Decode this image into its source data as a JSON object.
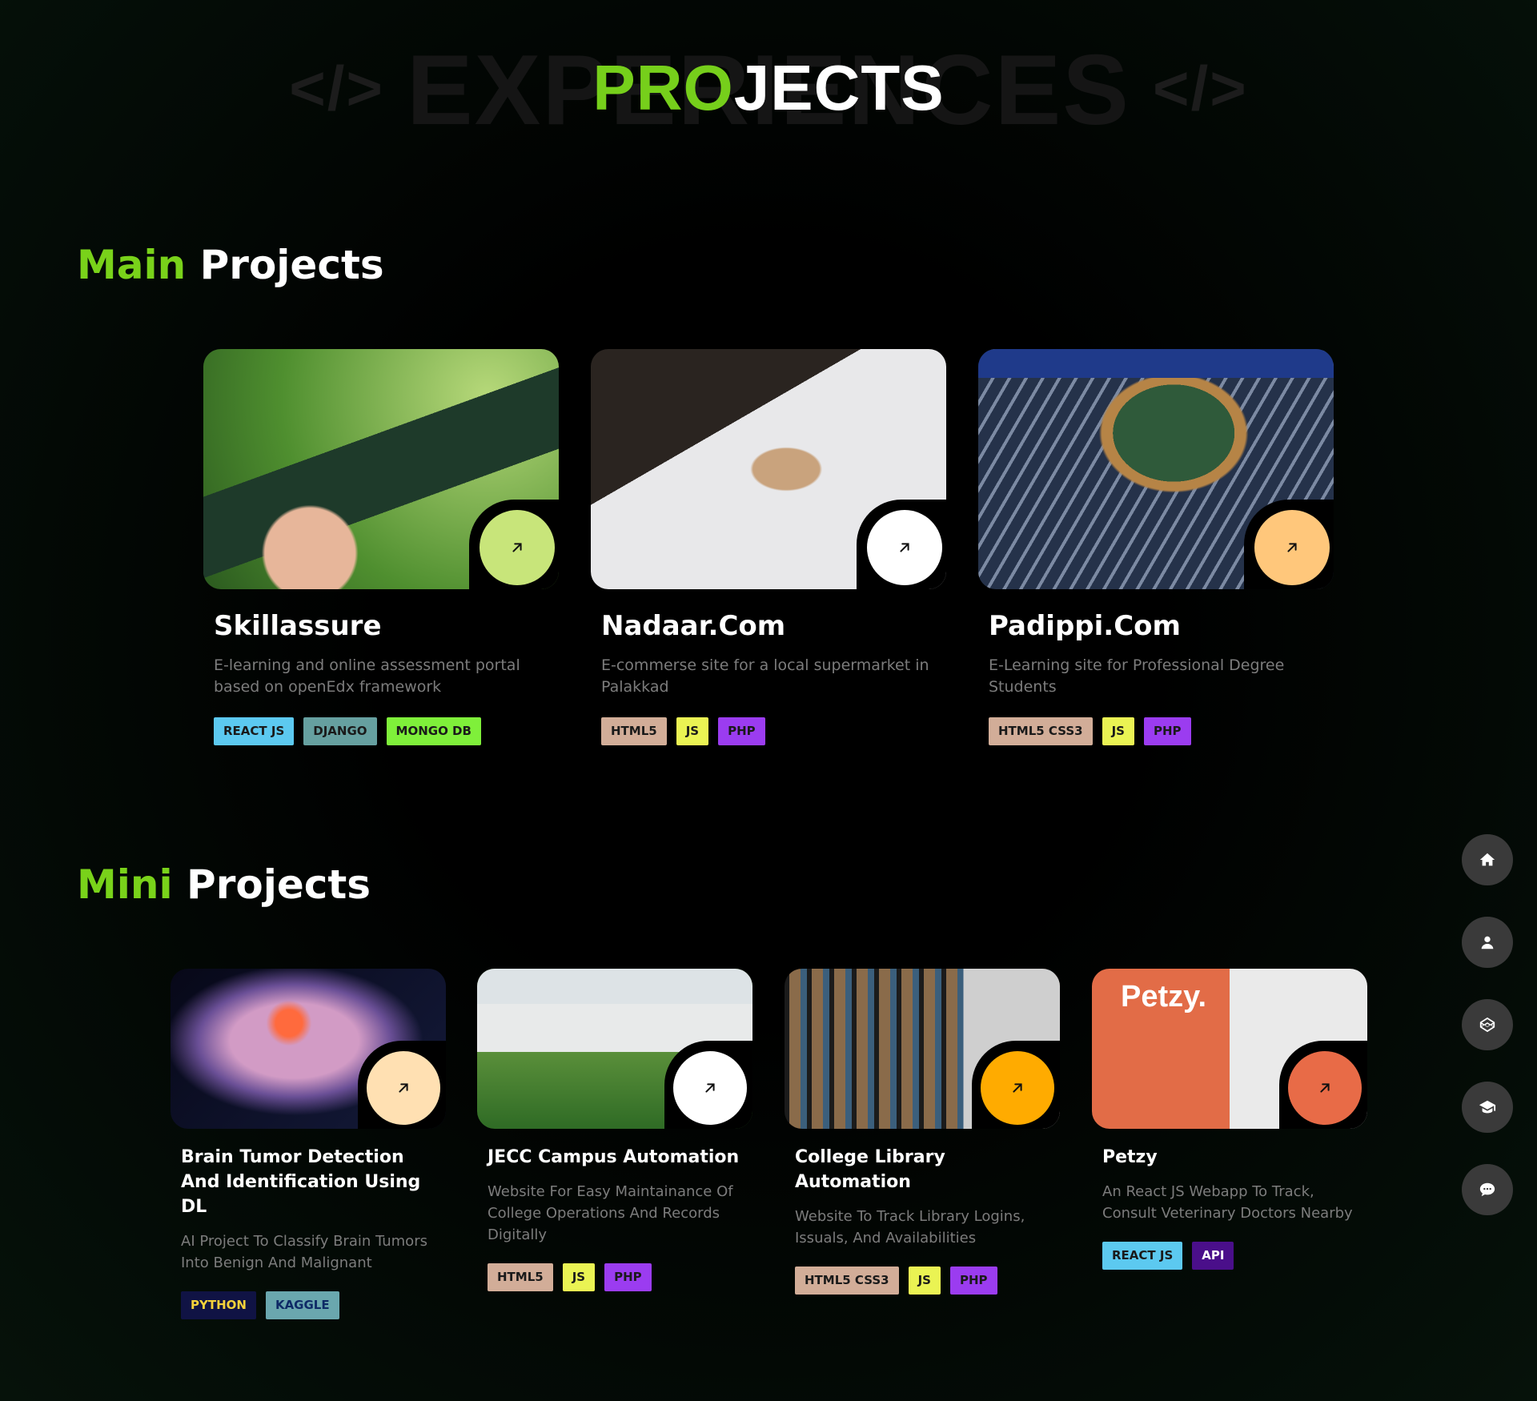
{
  "hero": {
    "bg_code_left": "</>",
    "bg_word": "EXPERIENCES",
    "bg_code_right": "</>",
    "title_accent": "PRO",
    "title_rest": "JECTS"
  },
  "main_section": {
    "accent": "Main",
    "rest": " Projects"
  },
  "mini_section": {
    "accent": "Mini",
    "rest": " Projects"
  },
  "main_projects": [
    {
      "title": "Skillassure",
      "description": "E-learning and online assessment portal based on openEdx framework",
      "image_icon": "e-learning-tablet-image",
      "arrow_color": "#c8e57a",
      "tags": [
        {
          "label": "REACT JS",
          "color": "#5cc9f0"
        },
        {
          "label": "DJANGO",
          "color": "#66a0a0"
        },
        {
          "label": "MONGO DB",
          "color": "#7ff03a"
        }
      ]
    },
    {
      "title": "Nadaar.Com",
      "description": "E-commerse site for a local supermarket in Palakkad",
      "image_icon": "shopping-cart-image",
      "arrow_color": "#ffffff",
      "tags": [
        {
          "label": "HTML5",
          "color": "#d2ad98"
        },
        {
          "label": "JS",
          "color": "#eaf353"
        },
        {
          "label": "PHP",
          "color": "#9b3cf0"
        }
      ]
    },
    {
      "title": "Padippi.Com",
      "description": "E-Learning site for Professional Degree Students",
      "image_icon": "e-learning-keyboard-image",
      "arrow_color": "#ffc77b",
      "tags": [
        {
          "label": "HTML5 CSS3",
          "color": "#d2ad98"
        },
        {
          "label": "JS",
          "color": "#eaf353"
        },
        {
          "label": "PHP",
          "color": "#9b3cf0"
        }
      ]
    }
  ],
  "mini_projects": [
    {
      "title": "Brain Tumor Detection And Identification Using DL",
      "description": "AI Project To Classify Brain Tumors Into Benign And Malignant",
      "image_icon": "brain-scan-image",
      "arrow_color": "#ffe0b2",
      "tags": [
        {
          "label": "PYTHON",
          "color": "#101344",
          "text": "#f5d23a"
        },
        {
          "label": "KAGGLE",
          "color": "#6aa7ae",
          "text": "#0e2a66"
        }
      ]
    },
    {
      "title": "JECC Campus Automation",
      "description": "Website For Easy Maintainance Of College Operations And Records Digitally",
      "image_icon": "campus-building-image",
      "arrow_color": "#ffffff",
      "tags": [
        {
          "label": "HTML5",
          "color": "#d2ad98"
        },
        {
          "label": "JS",
          "color": "#eaf353"
        },
        {
          "label": "PHP",
          "color": "#9b3cf0"
        }
      ]
    },
    {
      "title": "College Library Automation",
      "description": "Website To Track Library Logins, Issuals, And Availabilities",
      "image_icon": "library-shelves-image",
      "arrow_color": "#ffab00",
      "tags": [
        {
          "label": "HTML5 CSS3",
          "color": "#d2ad98"
        },
        {
          "label": "JS",
          "color": "#eaf353"
        },
        {
          "label": "PHP",
          "color": "#9b3cf0"
        }
      ]
    },
    {
      "title": "Petzy",
      "description": "An React JS Webapp To Track, Consult Veterinary Doctors Nearby",
      "image_icon": "petzy-brand-image",
      "image_text": "Petzy.",
      "arrow_color": "#e86b47",
      "tags": [
        {
          "label": "REACT JS",
          "color": "#5cc9f0"
        },
        {
          "label": "API",
          "color": "#4a0f8a",
          "text": "#ffffff"
        }
      ]
    }
  ],
  "sidenav": [
    {
      "icon": "home-icon"
    },
    {
      "icon": "user-icon"
    },
    {
      "icon": "codepen-icon"
    },
    {
      "icon": "graduation-cap-icon"
    },
    {
      "icon": "chat-icon"
    }
  ]
}
